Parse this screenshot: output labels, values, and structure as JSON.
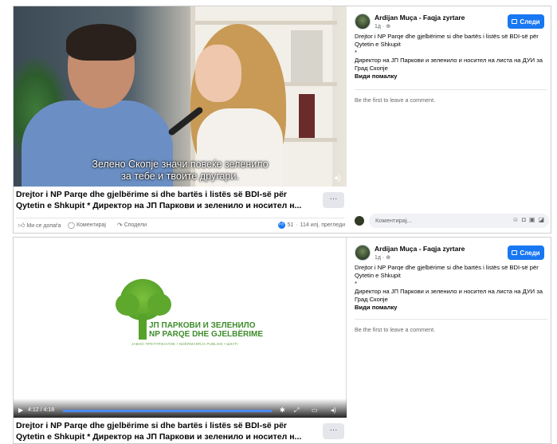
{
  "posts": [
    {
      "video": {
        "subtitle_line1": "Зелено Скопје значи повеќе зеленило",
        "subtitle_line2": "за тебе и твоите другари.",
        "volume_icon": "speaker-icon"
      },
      "title_line1": "Drejtor i NP Parqe dhe gjelbërime si dhe bartës i listës së BDI-së për",
      "title_line2": "Qytetin e Shkupit * Директор на ЈП Паркови и зеленило и носител н...",
      "more_label": "···",
      "actions": {
        "like": "Ми се допаѓа",
        "comment": "Коментирај",
        "share": "Сподели"
      },
      "stats": {
        "reactions": "51",
        "views": "114 илј. прегледи"
      },
      "side": {
        "author": "Ardijan Muça - Faqja zyrtare",
        "meta": "1д · ⊕",
        "follow_label": "Следи",
        "desc_line1": "Drejtor i NP Parqe dhe gjelbërime si dhe bartës i listës së BDI-së për",
        "desc_line2": "Qytetin e Shkupit",
        "desc_line3": "*",
        "desc_line4": "Директор на ЈП Паркови и зеленило и носител на листа на ДУИ за",
        "desc_line5": "Град Скопје",
        "see_more": "Види помалку",
        "first_comment": "Be the first to leave a comment.",
        "comment_placeholder": "Коментирај..."
      }
    },
    {
      "video": {
        "logo_line1": "ЈП ПАРКОВИ И ЗЕЛЕНИЛО",
        "logo_line2": "NP PARQE DHE GJELBËRIME",
        "logo_sub": "ЈАВНО ПРЕТПРИЈАТИЕ • NDËRMARRJA PUBLIKE • ШКУП",
        "time": "4:12 / 4:18",
        "progress": 1.0
      },
      "title_line1": "Drejtor i NP Parqe dhe gjelbërime si dhe bartës i listës së BDI-së për",
      "title_line2": "Qytetin e Shkupit * Директор на ЈП Паркови и зеленило и носител н...",
      "more_label": "···",
      "side": {
        "author": "Ardijan Muça - Faqja zyrtare",
        "meta": "1д · ⊕",
        "follow_label": "Следи",
        "desc_line1": "Drejtor i NP Parqe dhe gjelbërime si dhe bartës i listës së BDI-së për",
        "desc_line2": "Qytetin e Shkupit",
        "desc_line3": "*",
        "desc_line4": "Директор на ЈП Паркови и зеленило и носител на листа на ДУИ за",
        "desc_line5": "Град Скопје",
        "see_more": "Види помалку",
        "first_comment": "Be the first to leave a comment."
      }
    }
  ],
  "colors": {
    "accent": "#1877f2",
    "logo_green": "#3c8c2a",
    "muted_text": "#65676b"
  }
}
